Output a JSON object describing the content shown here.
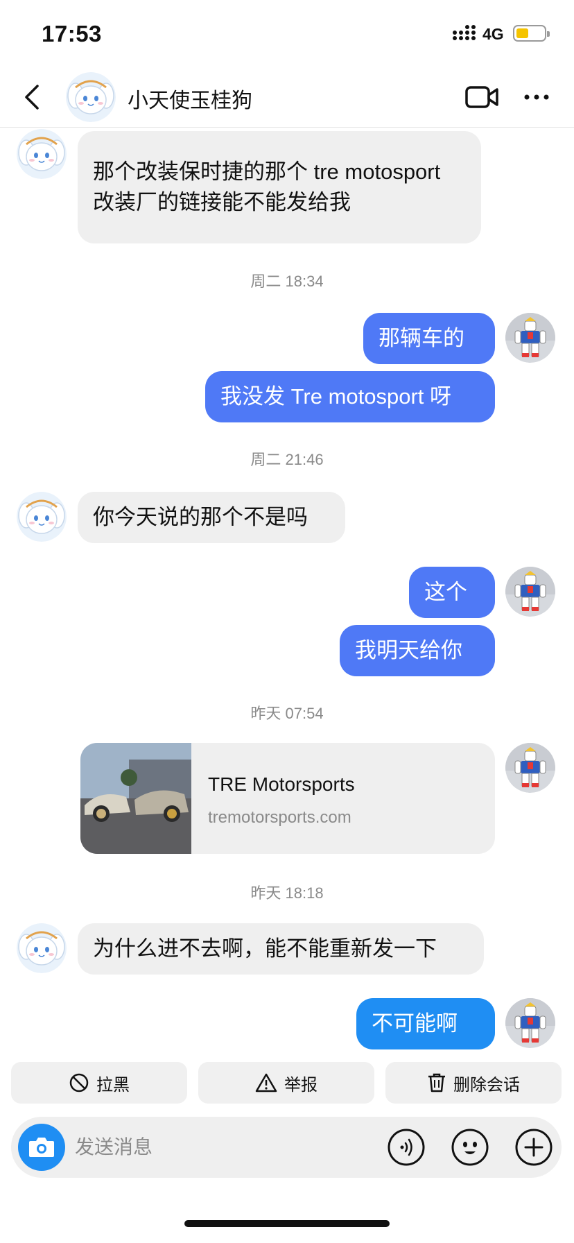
{
  "status_bar": {
    "time": "17:53",
    "network": "4G"
  },
  "header": {
    "contact_name": "小天使玉桂狗"
  },
  "messages": [
    {
      "from": "them",
      "text": "那个改装保时捷的那个 tre motosport 改装厂的链接能不能发给我"
    },
    {
      "timestamp": "周二 18:34"
    },
    {
      "from": "me",
      "text": "那辆车的"
    },
    {
      "from": "me",
      "text": "我没发 Tre motosport 呀"
    },
    {
      "timestamp": "周二 21:46"
    },
    {
      "from": "them",
      "text": "你今天说的那个不是吗"
    },
    {
      "from": "me",
      "text": "这个"
    },
    {
      "from": "me",
      "text": "我明天给你"
    },
    {
      "timestamp": "昨天 07:54"
    },
    {
      "from": "me",
      "link": {
        "title": "TRE Motorsports",
        "domain": "tremotorsports.com"
      }
    },
    {
      "timestamp": "昨天 18:18"
    },
    {
      "from": "them",
      "text": "为什么进不去啊，能不能重新发一下"
    },
    {
      "from": "me",
      "text": "不可能啊"
    }
  ],
  "actions": {
    "block": "拉黑",
    "report": "举报",
    "delete": "删除会话"
  },
  "composer": {
    "placeholder": "发送消息"
  },
  "colors": {
    "outgoing_bubble": "#4f79f6",
    "last_outgoing_bubble": "#1f8ef3",
    "incoming_bubble": "#efefef",
    "camera_button": "#1f8ef3"
  },
  "icons": [
    "back-icon",
    "video-call-icon",
    "more-icon",
    "block-icon",
    "warning-icon",
    "trash-icon",
    "camera-icon",
    "voice-icon",
    "emoji-icon",
    "plus-icon"
  ]
}
